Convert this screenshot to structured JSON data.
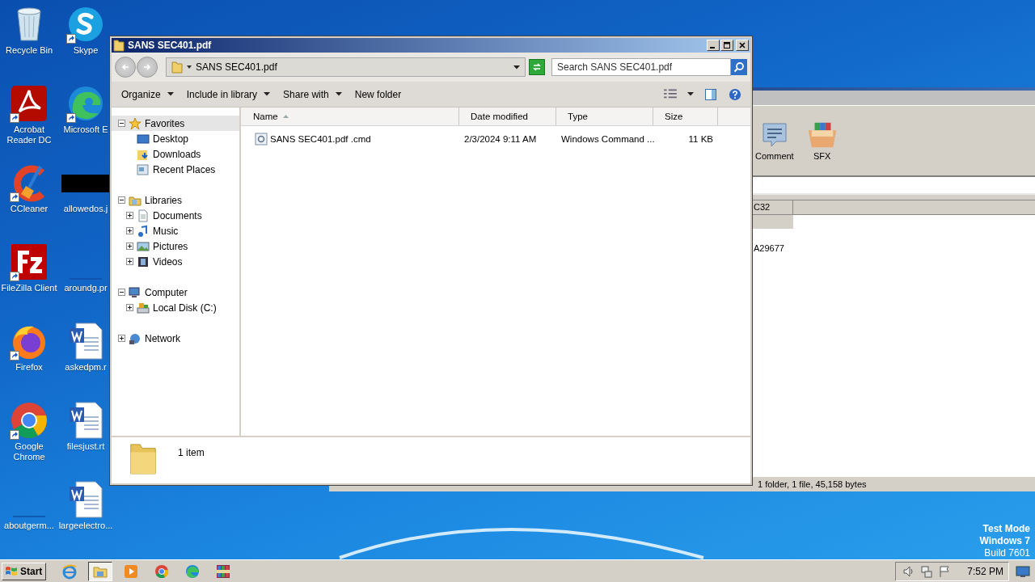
{
  "desktop_icons": [
    {
      "label": "Recycle Bin",
      "kind": "recycle",
      "shortcut": false
    },
    {
      "label": "Skype",
      "kind": "skype",
      "shortcut": true
    },
    {
      "label": "Acrobat Reader DC",
      "kind": "acrobat",
      "shortcut": true
    },
    {
      "label": "Microsoft E",
      "kind": "edge",
      "shortcut": true
    },
    {
      "label": "CCleaner",
      "kind": "ccleaner",
      "shortcut": true
    },
    {
      "label": "allowedos.j",
      "kind": "dark-thumbnail",
      "shortcut": false
    },
    {
      "label": "FileZilla Client",
      "kind": "filezilla",
      "shortcut": true
    },
    {
      "label": "aroundg.pr",
      "kind": "blank",
      "shortcut": false
    },
    {
      "label": "Firefox",
      "kind": "firefox",
      "shortcut": true
    },
    {
      "label": "askedpm.r",
      "kind": "word",
      "shortcut": false
    },
    {
      "label": "Google Chrome",
      "kind": "chrome",
      "shortcut": true
    },
    {
      "label": "filesjust.rt",
      "kind": "word",
      "shortcut": false
    },
    {
      "label": "aboutgerm...",
      "kind": "blank",
      "shortcut": false
    },
    {
      "label": "largeelectro...",
      "kind": "word",
      "shortcut": false
    }
  ],
  "archive_window": {
    "toolbar": [
      {
        "label": "Comment",
        "kind": "comment"
      },
      {
        "label": "SFX",
        "kind": "sfx"
      }
    ],
    "column_header": "C32",
    "cell": "A29677",
    "status": "1 folder, 1 file, 45,158 bytes"
  },
  "explorer": {
    "title": "SANS SEC401.pdf",
    "address": "SANS SEC401.pdf",
    "search": {
      "placeholder": "Search SANS SEC401.pdf"
    },
    "commands": [
      {
        "label": "Organize",
        "dropdown": true
      },
      {
        "label": "Include in library",
        "dropdown": true
      },
      {
        "label": "Share with",
        "dropdown": true
      },
      {
        "label": "New folder",
        "dropdown": false
      }
    ],
    "nav_tree": [
      {
        "label": "Favorites",
        "kind": "star",
        "expanded": true,
        "selected": true,
        "children": [
          {
            "label": "Desktop",
            "kind": "desktop",
            "selected": false
          },
          {
            "label": "Downloads",
            "kind": "downloads",
            "selected": false
          },
          {
            "label": "Recent Places",
            "kind": "recent",
            "selected": false
          }
        ]
      },
      {
        "label": "Libraries",
        "kind": "library",
        "expanded": true,
        "selected": false,
        "children": [
          {
            "label": "Documents",
            "kind": "documents",
            "expanded": false,
            "selected": false
          },
          {
            "label": "Music",
            "kind": "music",
            "expanded": false,
            "selected": false
          },
          {
            "label": "Pictures",
            "kind": "pictures",
            "expanded": false,
            "selected": false
          },
          {
            "label": "Videos",
            "kind": "videos",
            "expanded": false,
            "selected": false
          }
        ]
      },
      {
        "label": "Computer",
        "kind": "computer",
        "expanded": true,
        "selected": false,
        "children": [
          {
            "label": "Local Disk (C:)",
            "kind": "disk",
            "expanded": false,
            "selected": false
          }
        ]
      },
      {
        "label": "Network",
        "kind": "network",
        "expanded": false,
        "selected": false
      }
    ],
    "columns": [
      {
        "label": "Name",
        "sorted": true
      },
      {
        "label": "Date modified",
        "sorted": false
      },
      {
        "label": "Type",
        "sorted": false
      },
      {
        "label": "Size",
        "sorted": false
      }
    ],
    "files": [
      {
        "name": "SANS SEC401.pdf .cmd",
        "date": "2/3/2024 9:11 AM",
        "type": "Windows Command ...",
        "size": "11 KB"
      }
    ],
    "details": "1 item"
  },
  "os_info": [
    {
      "text": "Test Mode",
      "bold": true
    },
    {
      "text": "Windows 7",
      "bold": true
    },
    {
      "text": "Build 7601",
      "bold": false
    }
  ],
  "taskbar": {
    "start": "Start",
    "apps": [
      {
        "kind": "ie",
        "active": false
      },
      {
        "kind": "explorer",
        "active": true
      },
      {
        "kind": "media",
        "active": false
      },
      {
        "kind": "chrome",
        "active": false
      },
      {
        "kind": "edge",
        "active": false
      },
      {
        "kind": "winrar",
        "active": false
      }
    ],
    "time": "7:52 PM"
  }
}
